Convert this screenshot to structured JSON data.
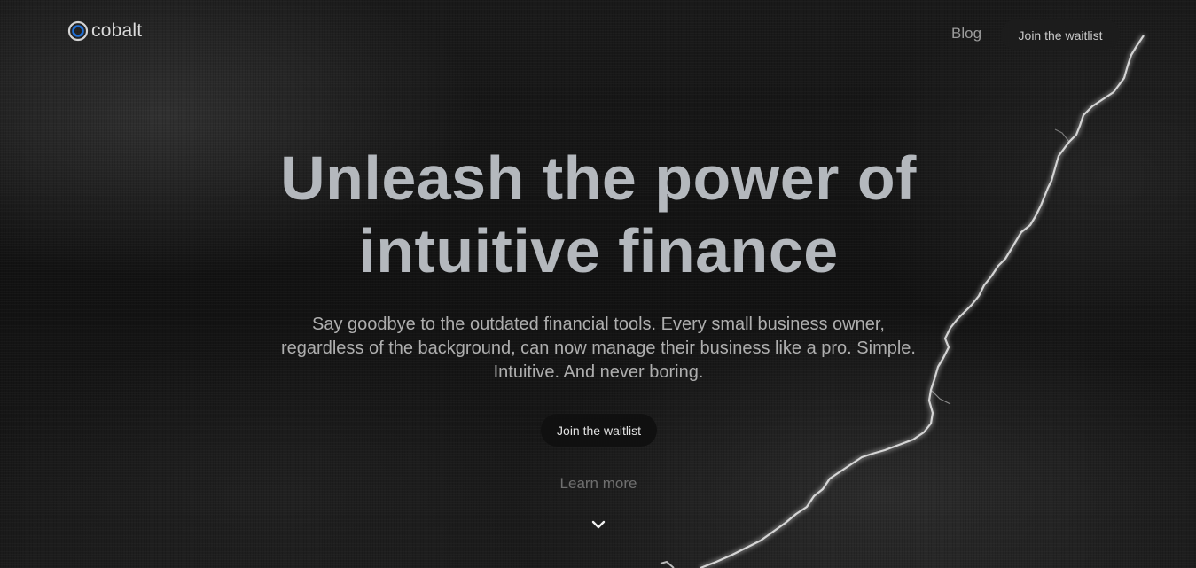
{
  "brand": {
    "name": "cobalt",
    "logo_icon": "cobalt-ring-logo",
    "accent_color": "#1f6fd6"
  },
  "nav": {
    "blog_label": "Blog",
    "cta_label": "Join the waitlist"
  },
  "hero": {
    "title_line1": "Unleash the power of",
    "title_line2": "intuitive finance",
    "subtitle_line1": "Say goodbye to the outdated financial tools. Every small business owner,",
    "subtitle_line2": "regardless of the background, can now manage their business like a pro. Simple.",
    "subtitle_line3": "Intuitive. And never boring.",
    "cta_label": "Join the waitlist",
    "learn_more_label": "Learn more",
    "scroll_icon": "chevron-down-icon"
  },
  "colors": {
    "background": "#141414",
    "title_text": "#b4b8bd",
    "body_text": "#aeaeae"
  }
}
